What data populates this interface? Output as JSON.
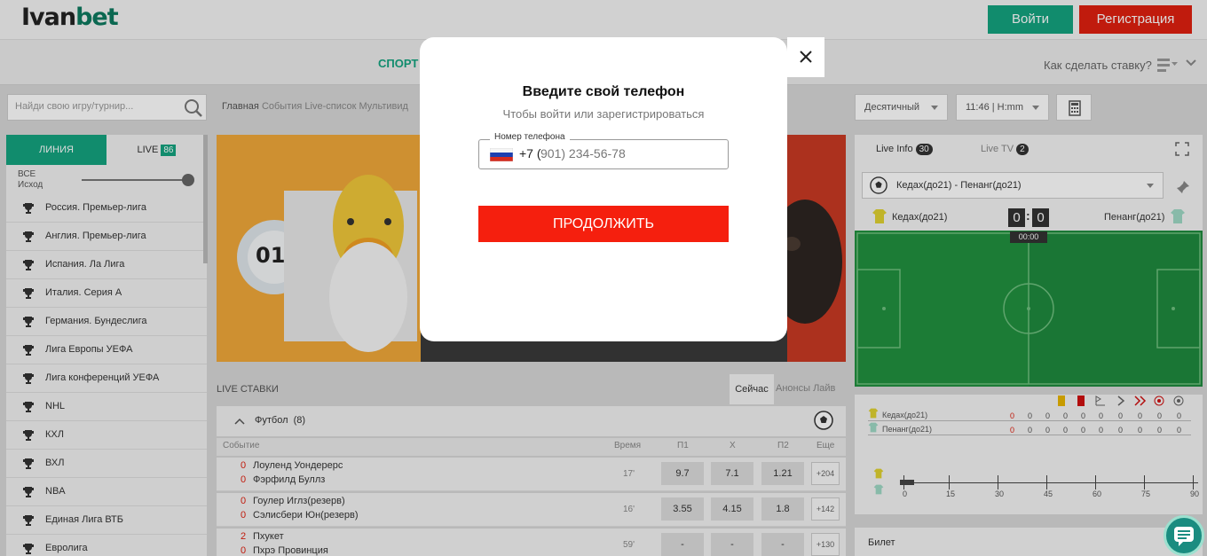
{
  "header": {
    "logo_text_1": "Ivan",
    "logo_text_2": "bet",
    "login_label": "Войти",
    "register_label": "Регистрация"
  },
  "nav": {
    "sport_label": "СПОРТ",
    "howto_label": "Как сделать ставку?"
  },
  "toolbar": {
    "search_placeholder": "Найди свою игру/турнир...",
    "crumbs": [
      "Главная",
      "События",
      "Live-список",
      "Мультивид"
    ],
    "odds_format": "Десятичный",
    "time_format": "11:46 | H:mm"
  },
  "left_panel": {
    "tab_line": "ЛИНИЯ",
    "tab_live": "LIVE",
    "live_count": "86",
    "filter_all": "ВСЕ",
    "filter_outcome": "Исход",
    "leagues": [
      "Россия. Премьер-лига",
      "Англия. Премьер-лига",
      "Испания. Ла Лига",
      "Италия. Серия А",
      "Германия. Бундеслига",
      "Лига Европы УЕФА",
      "Лига конференций УЕФА",
      "NHL",
      "КХЛ",
      "ВХЛ",
      "NBA",
      "Единая Лига ВТБ",
      "Евролига"
    ]
  },
  "banner": {
    "badge_number": "01"
  },
  "live": {
    "title": "LIVE СТАВКИ",
    "tab_now": "Сейчас",
    "tab_announce": "Анонсы Лайв",
    "sport_label": "Футбол",
    "sport_count": "(8)",
    "columns": {
      "event": "Событие",
      "time": "Время",
      "p1": "П1",
      "x": "Х",
      "p2": "П2",
      "more": "Еще"
    },
    "matches": [
      {
        "score1": "0",
        "team1": "Лоуленд Уондерерс",
        "score2": "0",
        "team2": "Фэрфилд Буллз",
        "time": "17'",
        "p1": "9.7",
        "x": "7.1",
        "p2": "1.21",
        "more": "+204"
      },
      {
        "score1": "0",
        "team1": "Гоулер Иглз(резерв)",
        "score2": "0",
        "team2": "Сэлисбери Юн(резерв)",
        "time": "16'",
        "p1": "3.55",
        "x": "4.15",
        "p2": "1.8",
        "more": "+142"
      },
      {
        "score1": "2",
        "team1": "Пхукет",
        "score2": "0",
        "team2": "Пхрэ Провинция",
        "time": "59'",
        "p1": "-",
        "x": "-",
        "p2": "-",
        "more": "+130"
      }
    ]
  },
  "right_panel": {
    "live_info": "Live Info",
    "live_info_count": "30",
    "live_tv": "Live TV",
    "live_tv_count": "2",
    "match": "Кедах(до21) - Пенанг(до21)",
    "team_home": "Кедах(до21)",
    "team_away": "Пенанг(до21)",
    "score_home": "0",
    "score_away": "0",
    "clock": "00:00",
    "stats_team_home": "Кедах(до21)",
    "stats_team_away": "Пенанг(до21)",
    "timeline_ticks": [
      "0",
      "15",
      "30",
      "45",
      "60",
      "75",
      "90"
    ],
    "ticket_label": "Билет"
  },
  "modal": {
    "title": "Введите свой телефон",
    "subtitle": "Чтобы войти или зарегистрироваться",
    "phone_label": "Номер телефона",
    "phone_code": "+7 (",
    "phone_placeholder": "901) 234-56-78",
    "continue_label": "ПРОДОЛЖИТЬ"
  },
  "colors": {
    "accent_green": "#14a37f",
    "accent_red": "#e02010",
    "continue_red": "#f51f0e"
  }
}
